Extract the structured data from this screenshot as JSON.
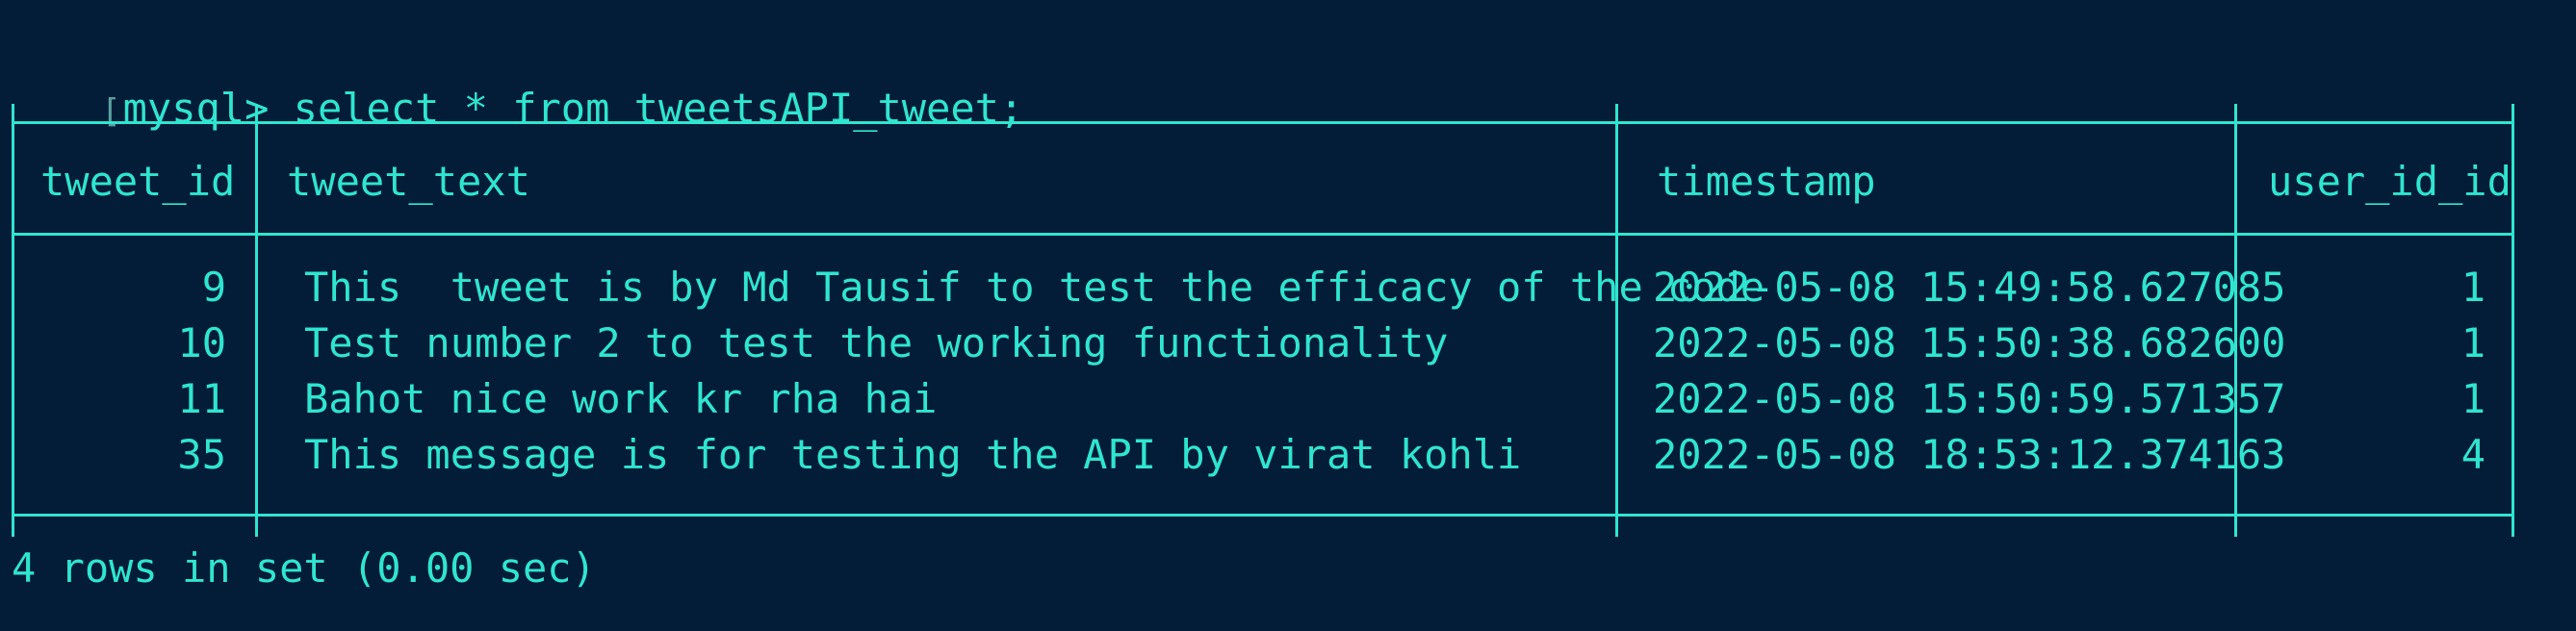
{
  "terminal": {
    "prompt": "mysql>",
    "command": "select * from tweetsAPI_tweet;",
    "result_summary": "4 rows in set (0.00 sec)"
  },
  "table": {
    "columns": [
      "tweet_id",
      "tweet_text",
      "timestamp",
      "user_id_id"
    ],
    "rows": [
      [
        "9",
        "This  tweet is by Md Tausif to test the efficacy of the code",
        "2022-05-08 15:49:58.627085",
        "1"
      ],
      [
        "10",
        "Test number 2 to test the working functionality",
        "2022-05-08 15:50:38.682600",
        "1"
      ],
      [
        "11",
        "Bahot nice work kr rha hai",
        "2022-05-08 15:50:59.571357",
        "1"
      ],
      [
        "35",
        "This message is for testing the API by virat kohli",
        "2022-05-08 18:53:12.374163",
        "4"
      ]
    ]
  },
  "colors": {
    "background": "#031c38",
    "text": "#2fe5cf"
  }
}
